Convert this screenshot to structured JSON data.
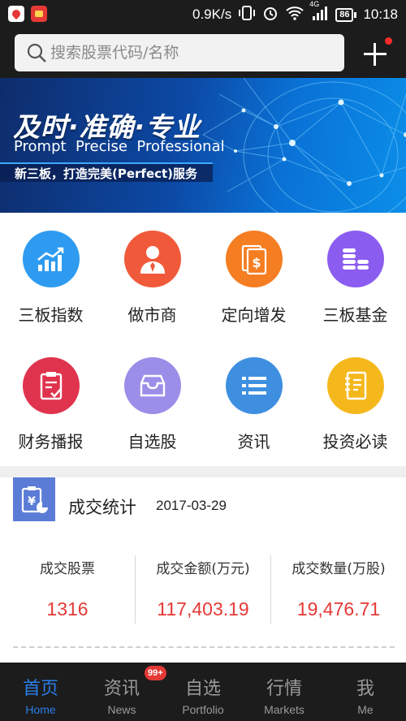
{
  "status_bar": {
    "speed": "0.9K/s",
    "network": "4G",
    "battery": "86",
    "time": "10:18"
  },
  "search": {
    "placeholder": "搜索股票代码/名称"
  },
  "banner": {
    "title": "及时·准确·专业",
    "subtitle": "Prompt  Precise  Professional",
    "slogan": "新三板，打造完美(Perfect)服务"
  },
  "grid": [
    {
      "label": "三板指数",
      "color": "#2e9bf0",
      "icon": "chart-up-icon"
    },
    {
      "label": "做市商",
      "color": "#f05a3a",
      "icon": "person-icon"
    },
    {
      "label": "定向增发",
      "color": "#f57d22",
      "icon": "document-dollar-icon"
    },
    {
      "label": "三板基金",
      "color": "#8b5cf0",
      "icon": "coins-icon"
    },
    {
      "label": "财务播报",
      "color": "#e0334e",
      "icon": "clipboard-check-icon"
    },
    {
      "label": "自选股",
      "color": "#9b8ee8",
      "icon": "inbox-icon"
    },
    {
      "label": "资讯",
      "color": "#3e8fe0",
      "icon": "list-icon"
    },
    {
      "label": "投资必读",
      "color": "#f5b81c",
      "icon": "notebook-icon"
    }
  ],
  "stats": {
    "title": "成交统计",
    "date": "2017-03-29",
    "columns": [
      {
        "label": "成交股票",
        "value": "1316"
      },
      {
        "label": "成交金额(万元)",
        "value": "117,403.19"
      },
      {
        "label": "成交数量(万股)",
        "value": "19,476.71"
      }
    ]
  },
  "nav": {
    "badge": "99+",
    "tabs": [
      {
        "zh": "首页",
        "en": "Home"
      },
      {
        "zh": "资讯",
        "en": "News"
      },
      {
        "zh": "自选",
        "en": "Portfolio"
      },
      {
        "zh": "行情",
        "en": "Markets"
      },
      {
        "zh": "我",
        "en": "Me"
      }
    ]
  },
  "colors": {
    "accent": "#2a7ee8",
    "value_red": "#e53935",
    "bar_bg": "#1c1c1c"
  }
}
